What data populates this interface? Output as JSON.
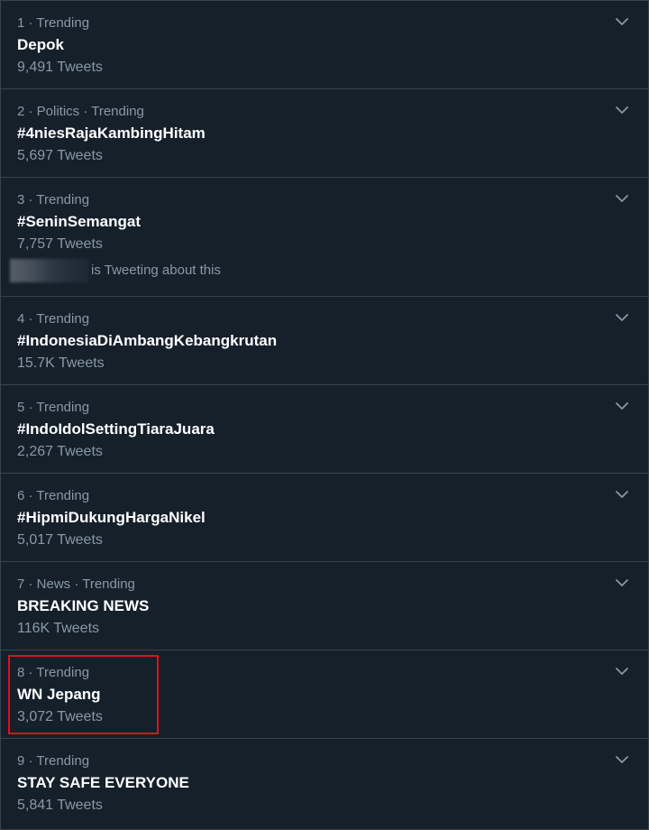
{
  "trends": [
    {
      "meta": "1 · Trending",
      "name": "Depok",
      "count": "9,491 Tweets"
    },
    {
      "meta": "2 · Politics · Trending",
      "name": "#4niesRajaKambingHitam",
      "count": "5,697 Tweets"
    },
    {
      "meta": "3 · Trending",
      "name": "#SeninSemangat",
      "count": "7,757 Tweets",
      "tweeting": "is Tweeting about this"
    },
    {
      "meta": "4 · Trending",
      "name": "#IndonesiaDiAmbangKebangkrutan",
      "count": "15.7K Tweets"
    },
    {
      "meta": "5 · Trending",
      "name": "#IndoIdolSettingTiaraJuara",
      "count": "2,267 Tweets"
    },
    {
      "meta": "6 · Trending",
      "name": "#HipmiDukungHargaNikel",
      "count": "5,017 Tweets"
    },
    {
      "meta": "7 · News · Trending",
      "name": "BREAKING NEWS",
      "count": "116K Tweets"
    },
    {
      "meta": "8 · Trending",
      "name": "WN Jepang",
      "count": "3,072 Tweets"
    },
    {
      "meta": "9 · Trending",
      "name": "STAY SAFE EVERYONE",
      "count": "5,841 Tweets"
    }
  ],
  "highlighted_trend_index": 7,
  "colors": {
    "background": "#15202b",
    "divider": "#38444d",
    "primary_text": "#ffffff",
    "secondary_text": "#8899a6",
    "highlight_box": "#e0101a"
  },
  "icons": {
    "more": "chevron-down-icon",
    "avatar": "blurred-avatar"
  }
}
